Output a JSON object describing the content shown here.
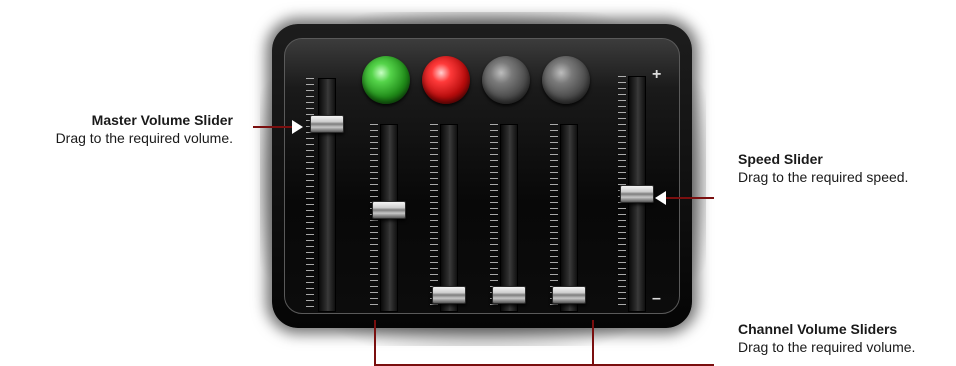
{
  "callouts": {
    "master": {
      "title": "Master Volume Slider",
      "desc": "Drag to the required volume."
    },
    "speed": {
      "title": "Speed Slider",
      "desc": "Drag to the required speed."
    },
    "channels": {
      "title": "Channel Volume Sliders",
      "desc": "Drag to the required volume."
    }
  },
  "mixer": {
    "speed_plus": "+",
    "speed_minus": "–",
    "indicator_lights": [
      {
        "name": "green",
        "color": "#2fb027",
        "state": "on"
      },
      {
        "name": "red",
        "color": "#e01a1a",
        "state": "on"
      },
      {
        "name": "grey",
        "color": "#7a7a7a",
        "state": "off"
      },
      {
        "name": "grey",
        "color": "#7a7a7a",
        "state": "off"
      }
    ],
    "sliders": {
      "master_volume": 0.83,
      "channel_volumes": [
        0.55,
        0.05,
        0.05,
        0.05
      ],
      "speed": 0.5
    }
  },
  "colors": {
    "callout_line": "#7a0f0f"
  }
}
